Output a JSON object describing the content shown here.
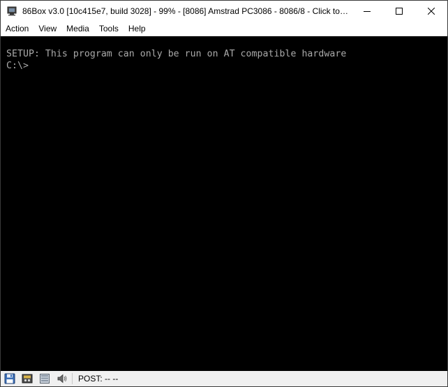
{
  "window": {
    "title": "86Box v3.0 [10c415e7, build 3028] - 99% - [8086] Amstrad PC3086 - 8086/8 - Click to cap...",
    "icon": "86box-app-icon"
  },
  "controls": {
    "minimize_icon": "minimize-icon",
    "maximize_icon": "maximize-icon",
    "close_icon": "close-icon"
  },
  "menu": {
    "items": [
      {
        "label": "Action"
      },
      {
        "label": "View"
      },
      {
        "label": "Media"
      },
      {
        "label": "Tools"
      },
      {
        "label": "Help"
      }
    ]
  },
  "screen": {
    "lines": [
      "SETUP: This program can only be run on AT compatible hardware",
      "C:\\>"
    ],
    "text_color": "#aaaaaa",
    "background": "#000000"
  },
  "statusbar": {
    "icons": [
      "floppy-disk-icon",
      "cassette-icon",
      "hard-disk-icon",
      "speaker-icon"
    ],
    "post_text": "POST: -- --"
  }
}
